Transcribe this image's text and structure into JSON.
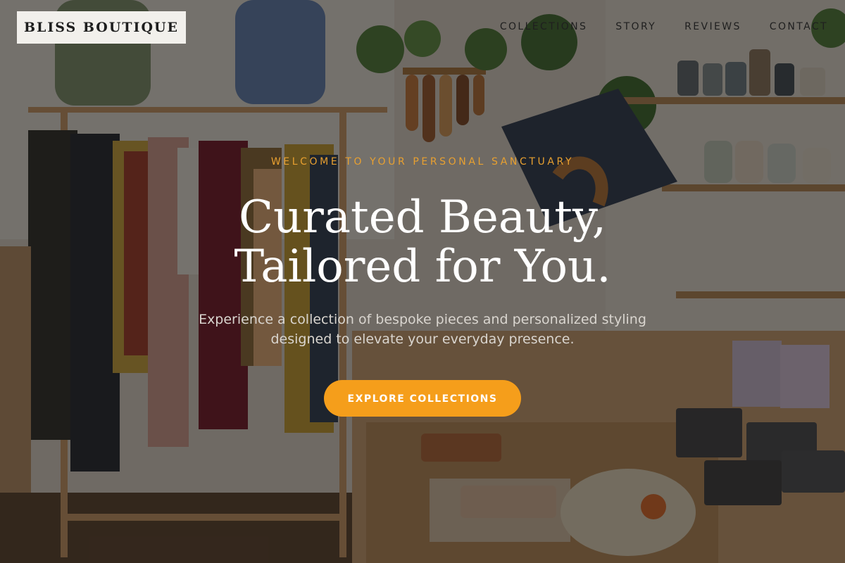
{
  "brand": {
    "logo_text": "BLISS BOUTIQUE"
  },
  "nav": {
    "items": [
      {
        "label": "COLLECTIONS"
      },
      {
        "label": "STORY"
      },
      {
        "label": "REVIEWS"
      },
      {
        "label": "CONTACT"
      }
    ]
  },
  "hero": {
    "eyebrow": "WELCOME TO YOUR PERSONAL SANCTUARY",
    "headline_line1": "Curated Beauty,",
    "headline_line2": "Tailored for You.",
    "subtitle": "Experience a collection of bespoke pieces and personalized styling designed to elevate your everyday presence.",
    "cta_label": "EXPLORE COLLECTIONS"
  },
  "colors": {
    "accent": "#f59e1b",
    "eyebrow": "#e8a030",
    "logo_bg": "#f2f0ec",
    "overlay": "#14100d"
  }
}
